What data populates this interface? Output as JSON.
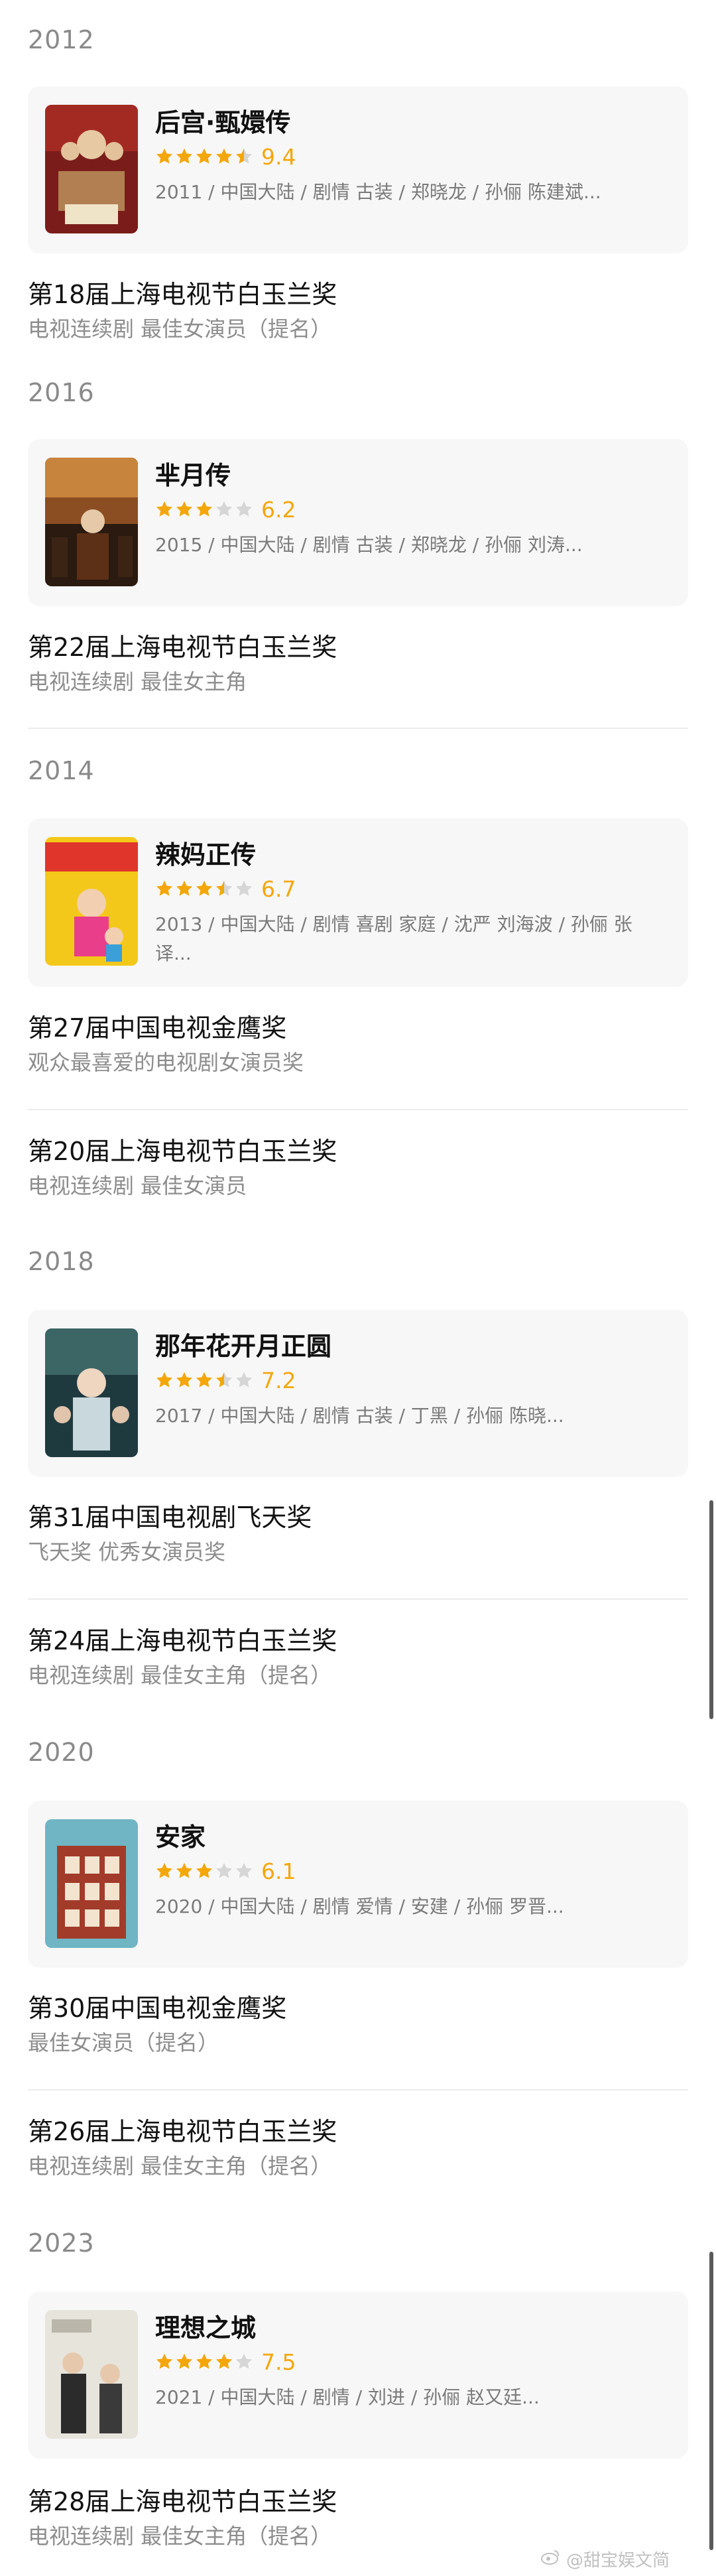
{
  "sections": [
    {
      "year": "2012",
      "drama": {
        "title": "后宫·甄嬛传",
        "stars": [
          1,
          1,
          1,
          1,
          0.5
        ],
        "score": "9.4",
        "meta": "2011 / 中国大陆 / 剧情 古装 / 郑晓龙 / 孙俪 陈建斌..."
      },
      "awards": [
        {
          "name": "第18届上海电视节白玉兰奖",
          "detail": "电视连续剧 最佳女演员（提名）"
        }
      ]
    },
    {
      "year": "2016",
      "drama": {
        "title": "芈月传",
        "stars": [
          1,
          1,
          1,
          0,
          0
        ],
        "score": "6.2",
        "meta": "2015 / 中国大陆 / 剧情 古装 / 郑晓龙 / 孙俪 刘涛..."
      },
      "awards": [
        {
          "name": "第22届上海电视节白玉兰奖",
          "detail": "电视连续剧 最佳女主角"
        }
      ]
    },
    {
      "year": "2014",
      "drama": {
        "title": "辣妈正传",
        "stars": [
          1,
          1,
          1,
          0.5,
          0
        ],
        "score": "6.7",
        "meta": "2013 / 中国大陆 / 剧情 喜剧 家庭 / 沈严 刘海波 / 孙俪 张译..."
      },
      "awards": [
        {
          "name": "第27届中国电视金鹰奖",
          "detail": "观众最喜爱的电视剧女演员奖"
        },
        {
          "name": "第20届上海电视节白玉兰奖",
          "detail": "电视连续剧 最佳女演员"
        }
      ]
    },
    {
      "year": "2018",
      "drama": {
        "title": "那年花开月正圆",
        "stars": [
          1,
          1,
          1,
          0.5,
          0
        ],
        "score": "7.2",
        "meta": "2017 / 中国大陆 / 剧情 古装 / 丁黑 / 孙俪 陈晓..."
      },
      "awards": [
        {
          "name": "第31届中国电视剧飞天奖",
          "detail": "飞天奖 优秀女演员奖"
        },
        {
          "name": "第24届上海电视节白玉兰奖",
          "detail": "电视连续剧 最佳女主角（提名）"
        }
      ]
    },
    {
      "year": "2020",
      "drama": {
        "title": "安家",
        "stars": [
          1,
          1,
          1,
          0,
          0
        ],
        "score": "6.1",
        "meta": "2020 / 中国大陆 / 剧情 爱情 / 安建 / 孙俪 罗晋..."
      },
      "awards": [
        {
          "name": "第30届中国电视金鹰奖",
          "detail": "最佳女演员（提名）"
        },
        {
          "name": "第26届上海电视节白玉兰奖",
          "detail": "电视连续剧 最佳女主角（提名）"
        }
      ]
    },
    {
      "year": "2023",
      "drama": {
        "title": "理想之城",
        "stars": [
          1,
          1,
          1,
          1,
          0
        ],
        "score": "7.5",
        "meta": "2021 / 中国大陆 / 剧情 / 刘进 / 孙俪 赵又廷..."
      },
      "awards": [
        {
          "name": "第28届上海电视节白玉兰奖",
          "detail": "电视连续剧 最佳女主角（提名）"
        }
      ]
    }
  ],
  "watermark": {
    "text": "@甜宝娱文简"
  },
  "colors": {
    "star_filled": "#f4a70a",
    "star_empty": "#d6d6d6",
    "score": "#f4a70a",
    "card_bg": "#f7f7f7"
  }
}
